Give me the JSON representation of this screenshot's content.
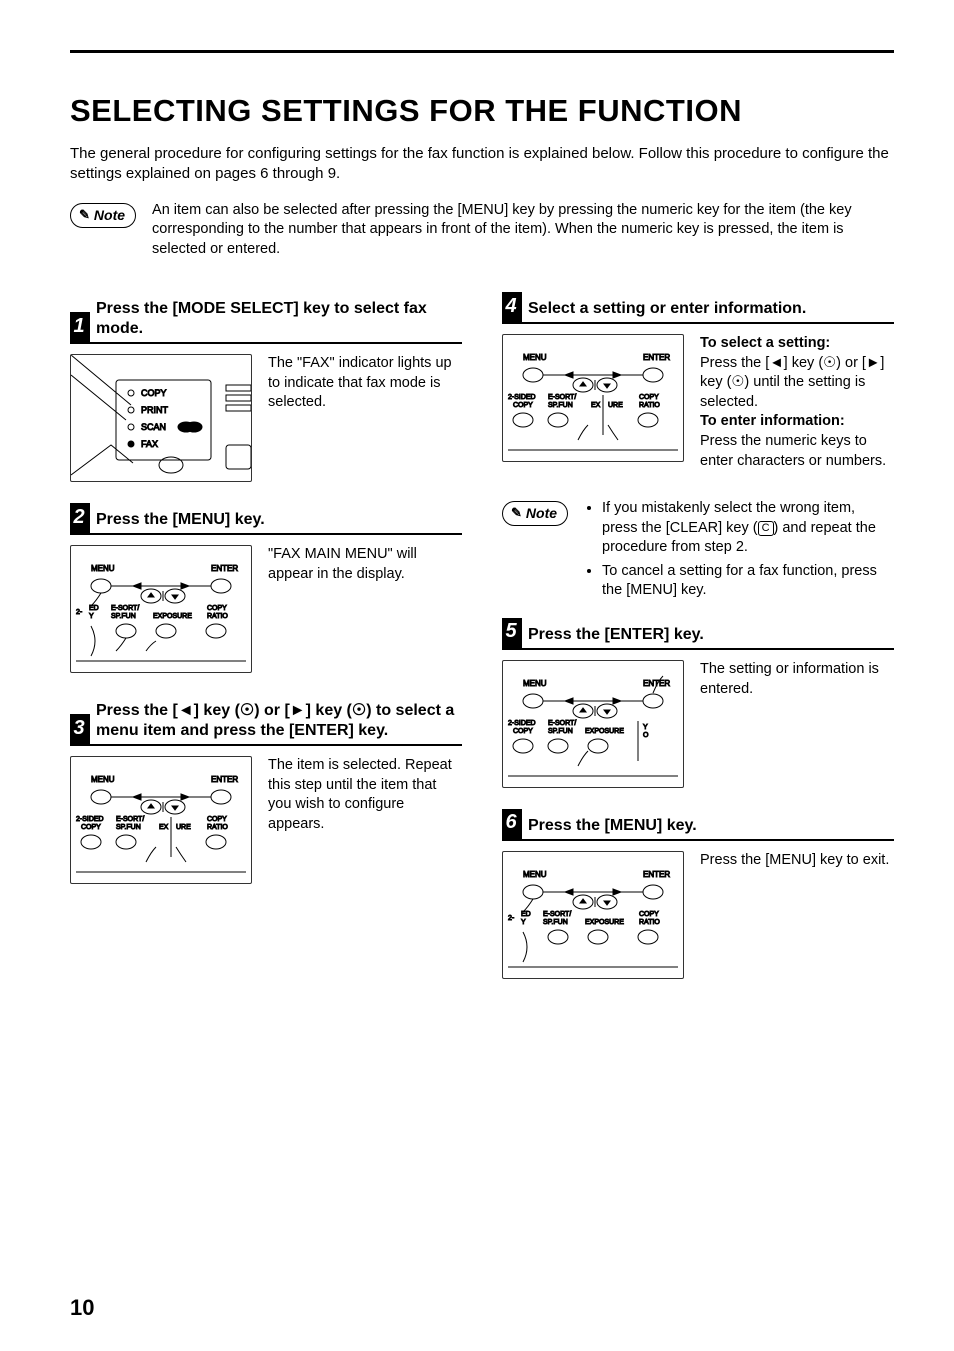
{
  "page_number": "10",
  "title": "SELECTING SETTINGS FOR THE FUNCTION",
  "intro": "The general procedure for configuring settings for the fax function is explained below. Follow this procedure to configure the settings explained on pages 6 through 9.",
  "top_note": "An item can also be selected after pressing the [MENU] key by pressing the numeric key for the item (the key corresponding to the number that appears in front of the item). When the numeric key is pressed, the item is selected or entered.",
  "note_label": "Note",
  "steps": {
    "s1": {
      "title": "Press the [MODE SELECT] key to select fax mode.",
      "desc": "The \"FAX\" indicator lights up to indicate that fax mode is selected."
    },
    "s2": {
      "title": "Press the [MENU] key.",
      "desc": "\"FAX MAIN MENU\" will appear in the display."
    },
    "s3": {
      "title_prefix": "Press the [",
      "title_mid1": "]  key (",
      "title_mid2": ") or  [",
      "title_mid3": "] key (",
      "title_suffix": ") to select a menu item and press the [ENTER] key.",
      "desc": "The item is selected. Repeat this step until the item that you wish to configure appears."
    },
    "s4": {
      "title": "Select a setting or enter information.",
      "sel_heading": "To select a setting:",
      "sel_body_pre": "Press the [",
      "sel_body_mid1": "]  key (",
      "sel_body_mid2": ") or [",
      "sel_body_mid3": "] key (",
      "sel_body_post": ") until the setting is selected.",
      "enter_heading": "To enter information:",
      "enter_body": "Press the numeric keys to enter characters or numbers."
    },
    "note2_li1_pre": "If you mistakenly select the wrong item, press the [CLEAR] key (",
    "note2_li1_post": ") and repeat the procedure from step 2.",
    "note2_li2": "To cancel a setting for a fax function, press the [MENU] key.",
    "s5": {
      "title": "Press the [ENTER] key.",
      "desc": "The setting or information is entered."
    },
    "s6": {
      "title": "Press the [MENU] key.",
      "desc": "Press the [MENU] key to exit."
    }
  },
  "panel_labels": {
    "copy": "COPY",
    "print": "PRINT",
    "scan": "SCAN",
    "fax": "FAX",
    "menu": "MENU",
    "enter": "ENTER",
    "twosided": "2-SIDED",
    "copy2": "COPY",
    "esort": "E-SORT/",
    "spfun": "SP.FUN",
    "exposure": "EXPOSURE",
    "ex": "EX",
    "ure": "URE",
    "ratio": "RATIO",
    "copyratio": "COPY"
  }
}
